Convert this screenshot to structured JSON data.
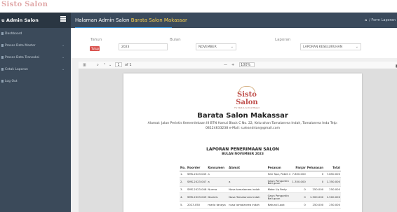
{
  "brand": {
    "logo_main": "Sisto",
    "logo_accent": "Salon"
  },
  "sidebar": {
    "title": "u Admin Salon",
    "items": [
      {
        "label": "Dashboard",
        "has_children": false
      },
      {
        "label": "Proses Data Master",
        "has_children": true
      },
      {
        "label": "Proses Data Transaksi",
        "has_children": true
      },
      {
        "label": "Cetak Laporan",
        "has_children": true
      },
      {
        "label": "Log Out",
        "has_children": false
      }
    ]
  },
  "header": {
    "title_prefix": "Halaman Admin Salon",
    "title_salon": "Barata Salon Makassar",
    "breadcrumb": "/ Form Laporan"
  },
  "filter": {
    "tahun_label": "Tahun",
    "tahun_value": "2023",
    "bulan_label": "Bulan",
    "bulan_value": "NOVEMBER",
    "laporan_label": "Laporan",
    "laporan_value": "LAPORAN KESELURUHAN",
    "button_label": "Tutup"
  },
  "pdf_toolbar": {
    "page_current": "1",
    "page_total": "of 1",
    "zoom": "100%",
    "zoom_minus": "—",
    "zoom_plus": "+"
  },
  "report": {
    "logo_main": "Sisto Salon",
    "logo_sub": "For Web & Android Based",
    "salon_name": "Barata Salon Makassar",
    "address_line1": "Alamat: Jalan Perintis Kemerdekaan III BTN Hamzi Block C No. 22, Kelurahan Tamalanrea Indah, Tamalanrea Inda Telp:",
    "address_line2": "08124633238 e-Mail: suleandrian@gmail.com",
    "title": "LAPORAN PENERIMAAN SALON",
    "subtitle": "BULAN NOVEMBER 2023",
    "columns": [
      "No.",
      "Noorder",
      "Konsumen",
      "Alamat",
      "Pesanan",
      "Panjar",
      "Pelunasan",
      "Total"
    ],
    "rows": [
      [
        "1.",
        "SMS.2023.045",
        "a",
        "",
        "Hair Spa, Paket 4",
        "7.850.000",
        "0",
        "7.850.000"
      ],
      [
        "2.",
        "SMS.2023.047",
        "a",
        "a",
        "Gaun Pengantin Bali gaun",
        "1.350.000",
        "0",
        "1.350.000"
      ],
      [
        "3.",
        "SMS.2023.048",
        "Nurma",
        "Nusa tamalanrea indah",
        "Make Up Party",
        "0",
        "250.000",
        "250.000"
      ],
      [
        "4.",
        "SMS.2023.049",
        "Daniels",
        "Nusa Tamalanrea Indah",
        "Gaun Pengantin Bali gaun",
        "0",
        "1.500.000",
        "1.500.000"
      ],
      [
        "5.",
        "2023.050",
        "maria tanaya",
        "nusa tamalanrea indah",
        "Natural Look",
        "0",
        "250.000",
        "250.000"
      ]
    ]
  }
}
